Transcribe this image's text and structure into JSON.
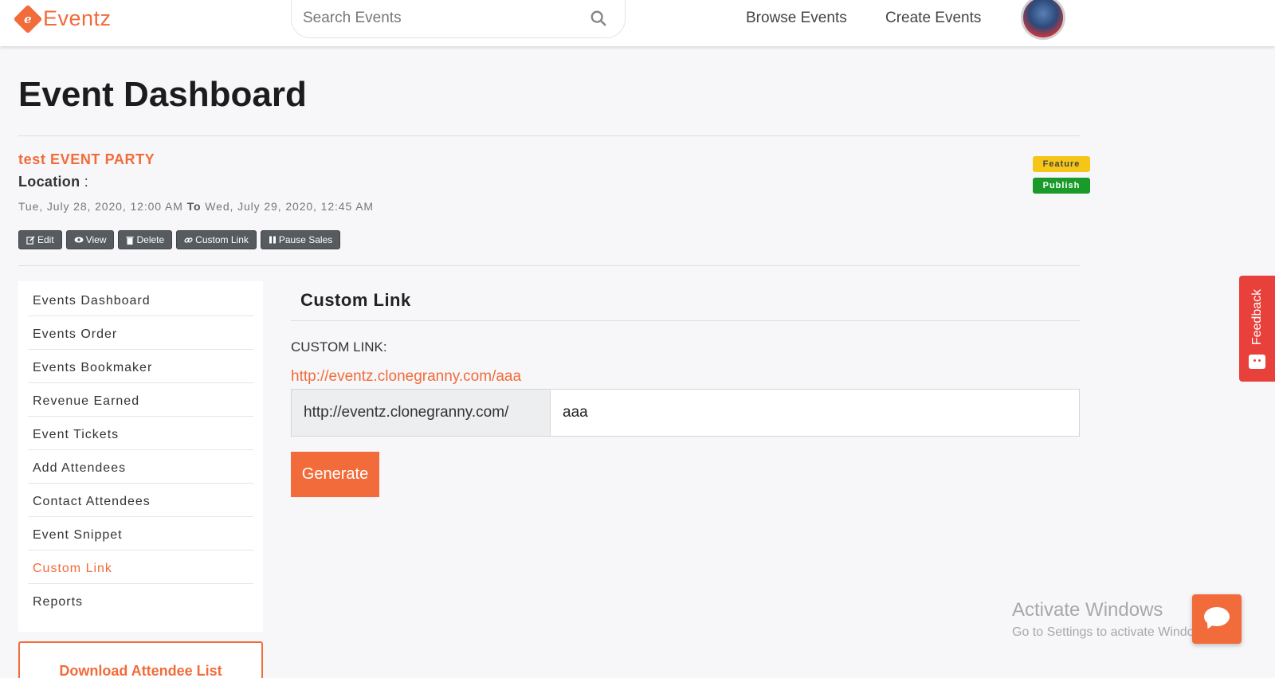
{
  "header": {
    "logo_letter": "e",
    "logo_text": "Eventz",
    "search_placeholder": "Search Events",
    "nav": [
      "Browse Events",
      "Create Events"
    ]
  },
  "page": {
    "title": "Event Dashboard"
  },
  "event": {
    "name": "test EVENT PARTY",
    "location_label": "Location",
    "location_colon": " :",
    "start": "Tue, July 28, 2020, 12:00 AM",
    "to_label": "To",
    "end": "Wed, July 29, 2020, 12:45 AM",
    "badges": {
      "feature": "Feature",
      "publish": "Publish"
    },
    "actions": {
      "edit": "Edit",
      "view": "View",
      "delete": "Delete",
      "custom_link": "Custom Link",
      "pause_sales": "Pause Sales"
    }
  },
  "sidebar": {
    "items": [
      "Events Dashboard",
      "Events Order",
      "Events Bookmaker",
      "Revenue Earned",
      "Event Tickets",
      "Add Attendees",
      "Contact Attendees",
      "Event Snippet",
      "Custom Link",
      "Reports"
    ],
    "active_index": 8,
    "download_label": "Download Attendee List"
  },
  "panel": {
    "title": "Custom Link",
    "label": "CUSTOM LINK:",
    "link": "http://eventz.clonegranny.com/aaa",
    "prefix": "http://eventz.clonegranny.com/",
    "value": "aaa",
    "generate": "Generate"
  },
  "feedback": {
    "label": "Feedback"
  },
  "watermark": {
    "title": "Activate Windows",
    "subtitle": "Go to Settings to activate Windows."
  },
  "colors": {
    "accent": "#f26b3a",
    "feature_badge": "#f5c518",
    "publish_badge": "#1a9a2b",
    "feedback": "#e8413c",
    "action_button": "#555b5f"
  },
  "icons": {
    "search": "search-icon",
    "edit": "edit-icon",
    "view": "eye-icon",
    "delete": "trash-icon",
    "custom_link": "link-icon",
    "pause_sales": "pause-icon",
    "feedback": "feedback-face-icon",
    "chat": "chat-bubble-icon"
  }
}
